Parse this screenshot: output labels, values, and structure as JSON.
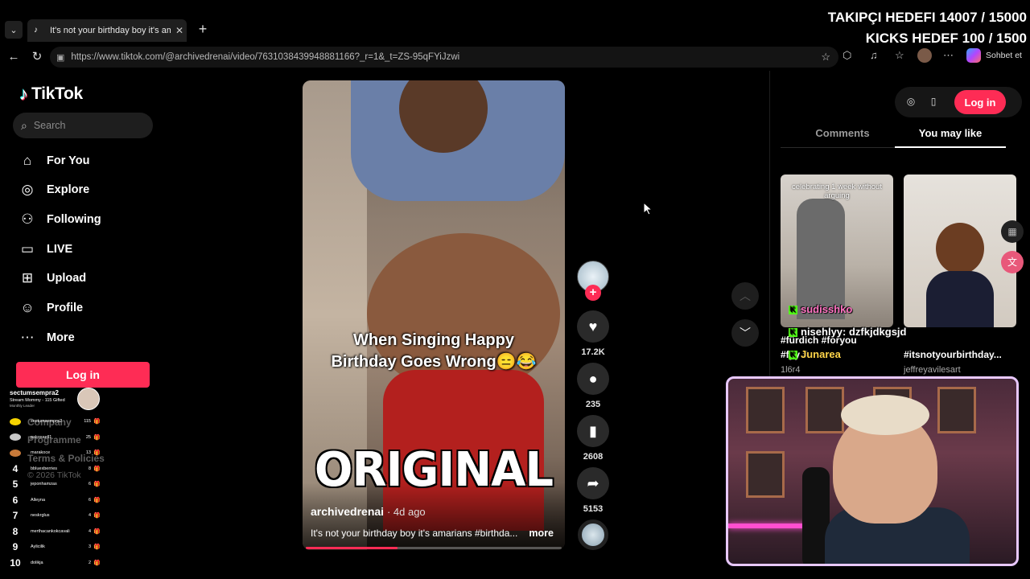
{
  "browser": {
    "tab_title": "It's not your birthday boy it's amarians",
    "url": "https://www.tiktok.com/@archivedrenai/video/7631038439948881166?_r=1&_t=ZS-95qFYiJzwi",
    "copilot_label": "Sohbet et"
  },
  "stream_overlay": {
    "follower_goal": "TAKIPÇI HEDEFI 14007 / 15000",
    "kicks_goal": "KICKS HEDEF 100 / 1500",
    "chat": [
      {
        "user": "sudisshko",
        "message": "",
        "color": "#ff73c2"
      },
      {
        "user": "nisehlyy",
        "message": ": dzfkjdkgsjd",
        "color": "#ffffff"
      },
      {
        "user": "Junarea",
        "message": "",
        "color": "#ffd54a"
      }
    ],
    "leaderboard": {
      "top_user": "sectumsempra2",
      "top_subtitle": "Stream Mommy - 115 Gifted",
      "top_note": "Monthly Leader",
      "rows": [
        {
          "rank": "",
          "user": "sectumsempra2",
          "score": "115",
          "lip_color": "#f5d300"
        },
        {
          "rank": "",
          "user": "pakosaell1",
          "score": "25",
          "lip_color": "#c8c8c8"
        },
        {
          "rank": "",
          "user": "marakoce",
          "score": "13",
          "lip_color": "#c87a3a"
        },
        {
          "rank": "4",
          "user": "bbluexberries",
          "score": "8",
          "lip_color": ""
        },
        {
          "rank": "5",
          "user": "jeponhamzas",
          "score": "6",
          "lip_color": ""
        },
        {
          "rank": "6",
          "user": "Alleyna",
          "score": "6",
          "lip_color": ""
        },
        {
          "rank": "7",
          "user": "neskrglus",
          "score": "4",
          "lip_color": ""
        },
        {
          "rank": "8",
          "user": "merthacankokcavali",
          "score": "4",
          "lip_color": ""
        },
        {
          "rank": "9",
          "user": "Aylicilik",
          "score": "3",
          "lip_color": ""
        },
        {
          "rank": "10",
          "user": "dolikja",
          "score": "2",
          "lip_color": ""
        }
      ]
    }
  },
  "tiktok": {
    "logo": "TikTok",
    "search_placeholder": "Search",
    "nav": [
      {
        "label": "For You",
        "icon": "home-icon"
      },
      {
        "label": "Explore",
        "icon": "compass-icon"
      },
      {
        "label": "Following",
        "icon": "following-icon"
      },
      {
        "label": "LIVE",
        "icon": "live-tv-icon"
      },
      {
        "label": "Upload",
        "icon": "upload-plus-icon"
      },
      {
        "label": "Profile",
        "icon": "profile-icon"
      },
      {
        "label": "More",
        "icon": "more-dots-icon"
      }
    ],
    "login_label": "Log in",
    "footer": {
      "company": "Company",
      "program": "Programme",
      "terms": "Terms & Policies",
      "copyright": "© 2026 TikTok"
    },
    "video": {
      "caption_line1": "When Singing Happy",
      "caption_line2": "Birthday Goes Wrong😑😂",
      "overlay_text": "ORIGINAL",
      "author": "archivedrenai",
      "age": "· 4d ago",
      "description": "It's not your birthday boy it's amarians #birthda...",
      "more_label": "more",
      "progress_fraction": 0.36
    },
    "actions": {
      "likes": "17.2K",
      "comments": "235",
      "saves": "2608",
      "shares": "5153"
    },
    "right_panel": {
      "login_label": "Log in",
      "tab_comments": "Comments",
      "tab_you_may_like": "You may like",
      "recommendations": [
        {
          "thumb_text": "celebrating 1 week without arguing",
          "caption": "#fürdich #foryou",
          "caption2": "#fyy #",
          "user": "1l6r4"
        },
        {
          "thumb_text": "",
          "caption": "#itsnotyourbirthday...",
          "caption2": "",
          "user": "jeffreyavilesart"
        }
      ]
    }
  }
}
